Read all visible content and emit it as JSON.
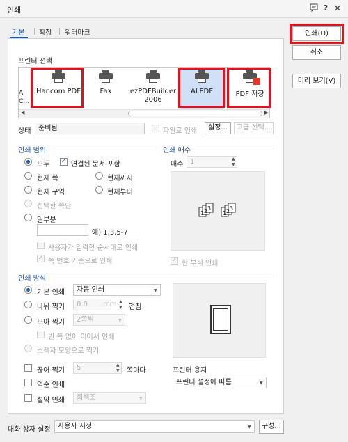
{
  "window": {
    "title": "인쇄"
  },
  "title_icons": {
    "chat": "chat-icon",
    "help": "?",
    "close": "×"
  },
  "tabs": [
    {
      "label": "기본"
    },
    {
      "label": "확장"
    },
    {
      "label": "워터마크"
    }
  ],
  "printer_select": {
    "label": "프린터 선택",
    "partial_left": "A\nC…",
    "items": [
      {
        "name": "Hancom PDF"
      },
      {
        "name": "Fax"
      },
      {
        "name": "ezPDFBuilder\n2006"
      },
      {
        "name": "ALPDF"
      },
      {
        "name": "PDF 저장"
      }
    ]
  },
  "status": {
    "label": "상태",
    "value": "준비됨",
    "file_print_label": "파일로 인쇄",
    "settings_button": "설정...",
    "advanced_button": "고급 선택..."
  },
  "print_range": {
    "label": "인쇄 범위",
    "all": "모두",
    "include_linked": "연결된 문서 포함",
    "current_page": "현재 쪽",
    "to_current": "현재까지",
    "current_section": "현재 구역",
    "from_current": "현재부터",
    "selection": "선택한 쪽만",
    "partial": "일부분",
    "example": "예) 1,3,5-7",
    "user_order": "사용자가 입력한 순서대로 인쇄",
    "by_page_number": "쪽 번호 기준으로 인쇄"
  },
  "copies": {
    "label": "인쇄 매수",
    "count_label": "매수",
    "count_value": "1",
    "collate": "한 부씩 인쇄"
  },
  "print_method": {
    "label": "인쇄 방식",
    "default_print": "기본 인쇄",
    "default_print_value": "자동 인쇄",
    "split_print": "나눠 찍기",
    "split_value": "0.0",
    "split_unit": "mm",
    "overlap": "겹침",
    "gather_print": "모아 찍기",
    "gather_value": "2쪽씩",
    "no_blank": "빈 쪽 없이 이어서 인쇄",
    "booklet": "소책자 모양으로 찍기",
    "spread_print": "끊어 찍기",
    "spread_value": "5",
    "per_page": "쪽마다",
    "reverse_print": "역순 인쇄",
    "eco_print": "절약 인쇄",
    "eco_value": "회색조"
  },
  "printer_paper": {
    "label": "프린터 용지",
    "value": "프린터 설정에 따름"
  },
  "dialog_settings": {
    "label": "대화 상자 설정",
    "value": "사용자 지정",
    "config_button": "구성..."
  },
  "side_buttons": {
    "print": "인쇄(D)",
    "cancel": "취소",
    "preview": "미리 보기(V)"
  },
  "copy_pages": [
    "1",
    "2",
    "3"
  ]
}
